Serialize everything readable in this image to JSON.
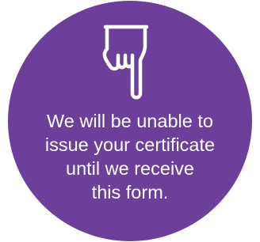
{
  "badge": {
    "background_color": "#6b3f9a",
    "icon": "pointing-down-hand-icon",
    "message_lines": [
      "We will be unable to",
      "issue your certificate",
      "until we receive",
      "this form."
    ]
  }
}
